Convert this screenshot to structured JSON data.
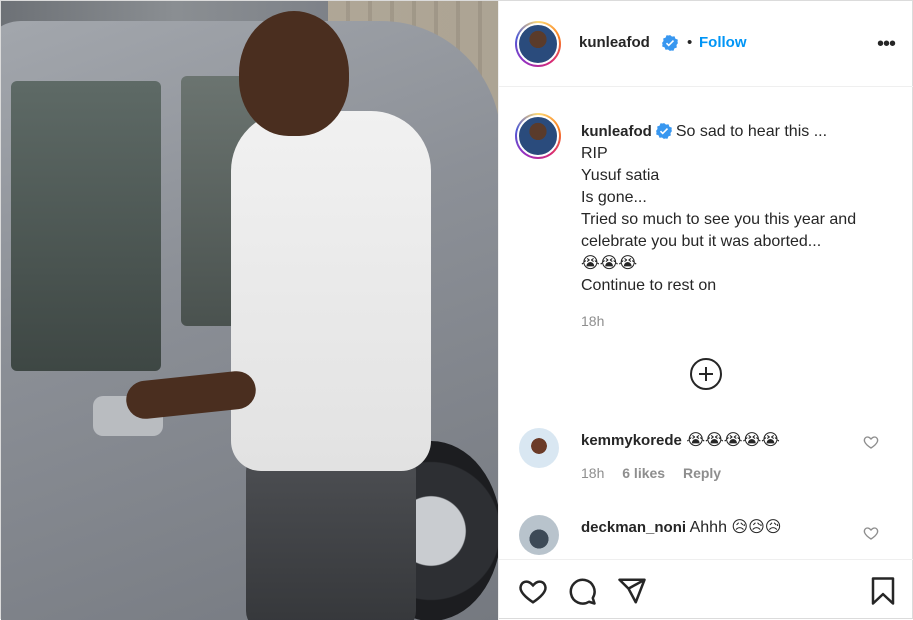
{
  "post": {
    "username": "kunleafod",
    "follow_label": "Follow",
    "separator": "•",
    "more_label": "•••",
    "verified_icon": "verified-badge-icon"
  },
  "caption": {
    "username": "kunleafod",
    "first_line": "So sad to hear this ...",
    "lines": [
      "RIP",
      "Yusuf satia",
      "Is gone...",
      "Tried so much to see you this year and celebrate you but it was aborted..."
    ],
    "emoji_line": "😭😭😭",
    "last_line": "Continue to rest on",
    "time": "18h"
  },
  "comments": [
    {
      "username": "kemmykorede",
      "text": "😭😭😭😭😭",
      "time": "18h",
      "likes": "6 likes",
      "reply": "Reply"
    },
    {
      "username": "deckman_noni",
      "text": "Ahhh 😥😥😥"
    }
  ],
  "colors": {
    "accent": "#0095f6",
    "text": "#262626",
    "muted": "#8e8e8e"
  },
  "icons": [
    "heart-icon",
    "comment-icon",
    "share-icon",
    "bookmark-icon",
    "load-more-icon"
  ]
}
